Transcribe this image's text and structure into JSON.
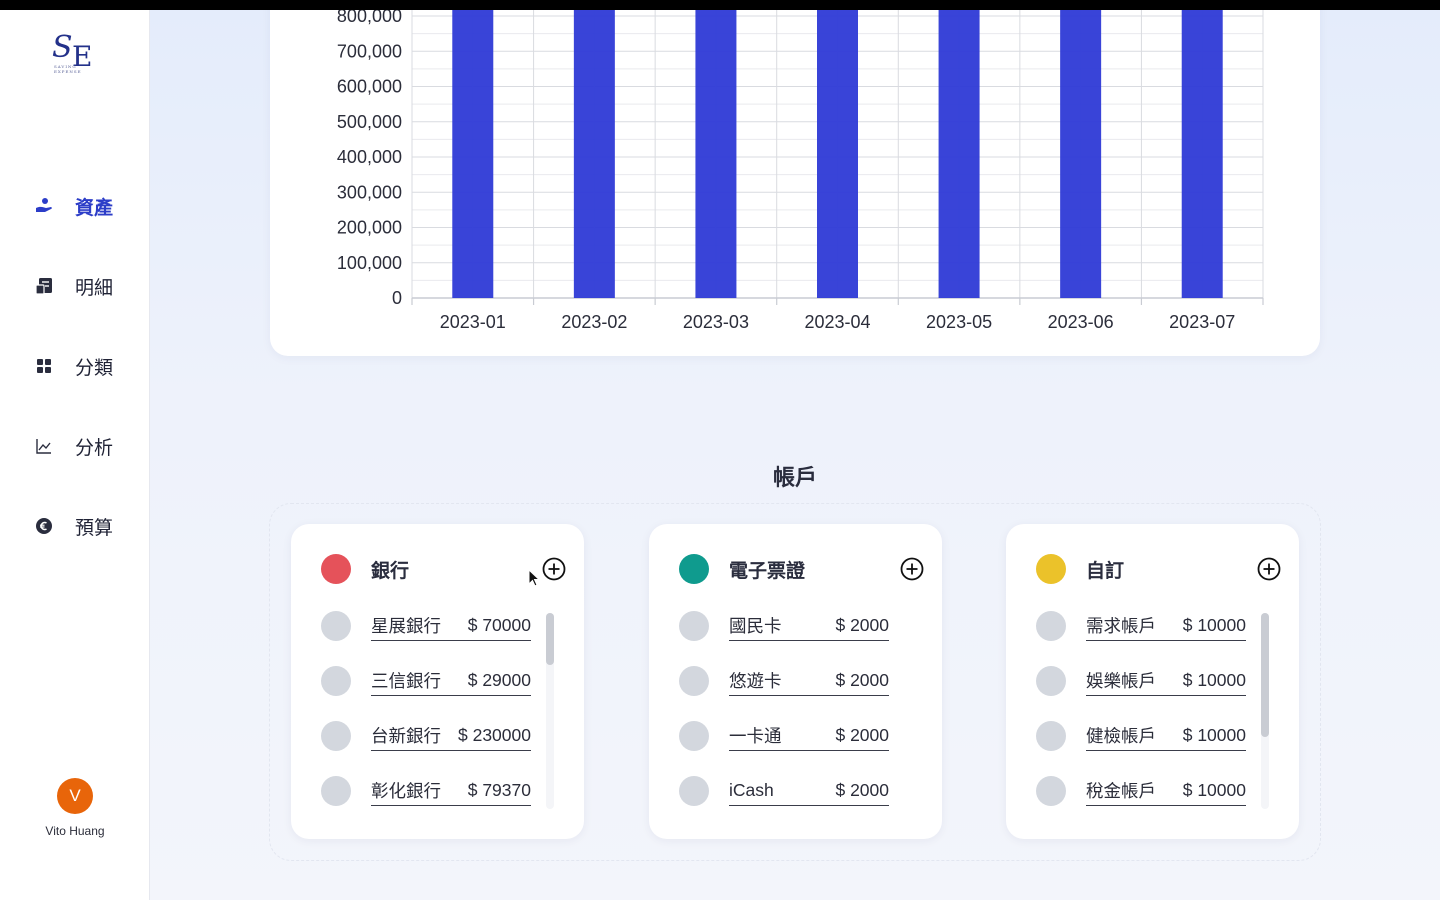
{
  "logo": {
    "s": "S",
    "e": "E",
    "tiny": "SAVING EXPENSE"
  },
  "nav": [
    {
      "label": "資產",
      "icon": "hand-coin-icon",
      "active": true
    },
    {
      "label": "明細",
      "icon": "receipt-icon",
      "active": false
    },
    {
      "label": "分類",
      "icon": "grid-icon",
      "active": false
    },
    {
      "label": "分析",
      "icon": "line-chart-icon",
      "active": false
    },
    {
      "label": "預算",
      "icon": "euro-coin-icon",
      "active": false
    }
  ],
  "user": {
    "initial": "V",
    "name": "Vito Huang",
    "avatar_color": "#e8650a"
  },
  "chart_data": {
    "type": "bar",
    "categories": [
      "2023-01",
      "2023-02",
      "2023-03",
      "2023-04",
      "2023-05",
      "2023-06",
      "2023-07"
    ],
    "y_ticks": [
      "0",
      "100,000",
      "200,000",
      "300,000",
      "400,000",
      "500,000",
      "600,000",
      "700,000",
      "800,000"
    ],
    "ylim": [
      0,
      800000
    ],
    "values_note": "all bars exceed visible top of 800,000",
    "series": [
      {
        "values": [
          800000,
          800000,
          800000,
          800000,
          800000,
          800000,
          800000
        ],
        "color": "#2e3ad6"
      }
    ],
    "grid": true
  },
  "accounts": {
    "title": "帳戶",
    "groups": [
      {
        "title": "銀行",
        "color": "#e5525a",
        "items": [
          {
            "name": "星展銀行",
            "amount": "$ 70000"
          },
          {
            "name": "三信銀行",
            "amount": "$ 29000"
          },
          {
            "name": "台新銀行",
            "amount": "$ 230000"
          },
          {
            "name": "彰化銀行",
            "amount": "$ 79370"
          }
        ]
      },
      {
        "title": "電子票證",
        "color": "#0f9b8e",
        "items": [
          {
            "name": "國民卡",
            "amount": "$ 2000"
          },
          {
            "name": "悠遊卡",
            "amount": "$ 2000"
          },
          {
            "name": "一卡通",
            "amount": "$ 2000"
          },
          {
            "name": "iCash",
            "amount": "$ 2000"
          }
        ]
      },
      {
        "title": "自訂",
        "color": "#ebc22a",
        "items": [
          {
            "name": "需求帳戶",
            "amount": "$ 10000"
          },
          {
            "name": "娛樂帳戶",
            "amount": "$ 10000"
          },
          {
            "name": "健檢帳戶",
            "amount": "$ 10000"
          },
          {
            "name": "稅金帳戶",
            "amount": "$ 10000"
          }
        ]
      }
    ]
  }
}
